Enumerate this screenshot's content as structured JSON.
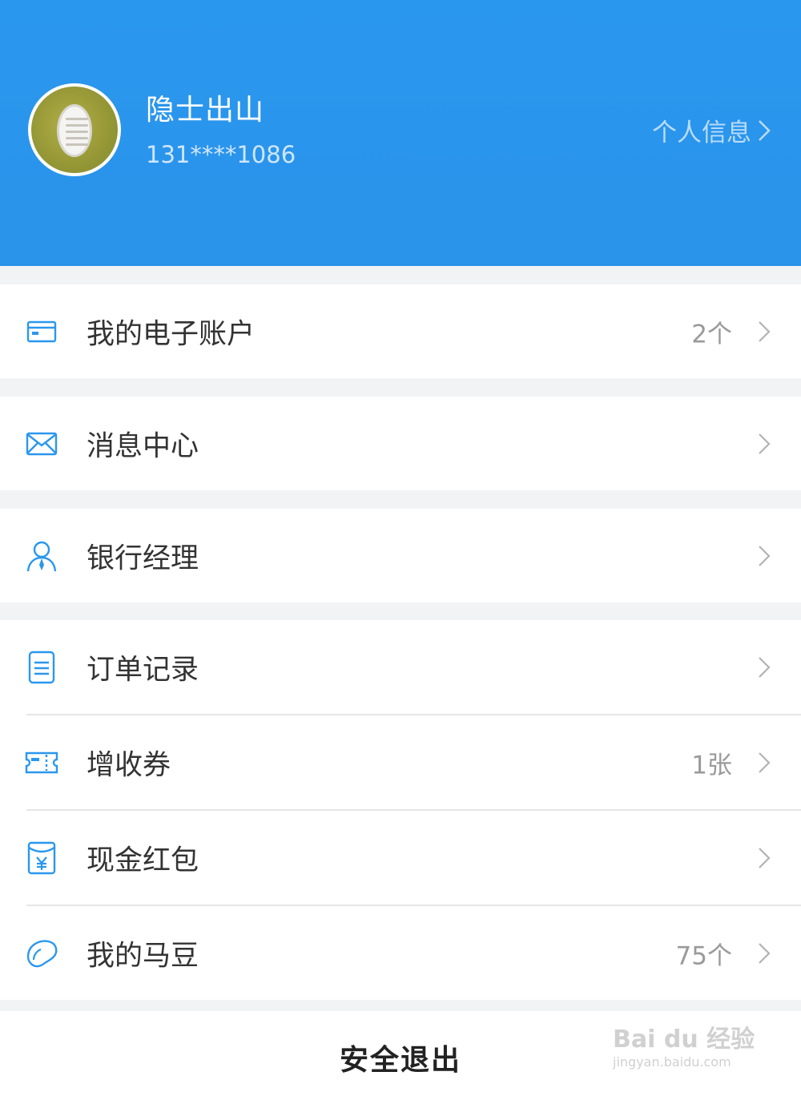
{
  "header": {
    "user_name": "隐士出山",
    "phone": "131****1086",
    "profile_link": "个人信息",
    "bg_color": "#2a97ee"
  },
  "menu": {
    "account": {
      "label": "我的电子账户",
      "value": "2个",
      "icon": "card-icon"
    },
    "messages": {
      "label": "消息中心",
      "value": "",
      "icon": "envelope-icon"
    },
    "manager": {
      "label": "银行经理",
      "value": "",
      "icon": "person-icon"
    },
    "orders": {
      "label": "订单记录",
      "value": "",
      "icon": "document-icon"
    },
    "coupons": {
      "label": "增收券",
      "value": "1张",
      "icon": "ticket-icon"
    },
    "redpacket": {
      "label": "现金红包",
      "value": "",
      "icon": "red-packet-icon"
    },
    "beans": {
      "label": "我的马豆",
      "value": "75个",
      "icon": "bean-icon"
    }
  },
  "logout": {
    "label": "安全退出"
  },
  "watermark": {
    "text": "Bai du 经验",
    "sub": "jingyan.baidu.com"
  },
  "accent_color": "#2a97ee"
}
